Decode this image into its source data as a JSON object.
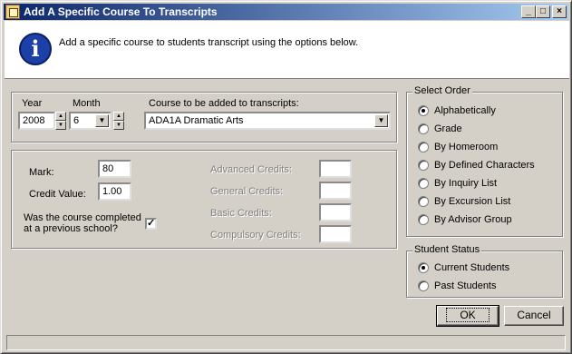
{
  "window": {
    "title": "Add A Specific Course To Transcripts",
    "controls": {
      "minimize": "_",
      "maximize": "□",
      "close": "×"
    }
  },
  "header": {
    "icon": "info-icon",
    "text": "Add a specific course to students transcript using the options below."
  },
  "course_selection": {
    "year_label": "Year",
    "year_value": "2008",
    "month_label": "Month",
    "month_value": "6",
    "course_label": "Course to be added to transcripts:",
    "course_value": "ADA1A  Dramatic Arts"
  },
  "details": {
    "mark_label": "Mark:",
    "mark_value": "80",
    "credit_label": "Credit Value:",
    "credit_value": "1.00",
    "prev_school_label_1": "Was the course completed",
    "prev_school_label_2": "at a previous school?",
    "prev_school_checked": true,
    "advanced_label": "Advanced Credits:",
    "general_label": "General Credits:",
    "basic_label": "Basic Credits:",
    "compulsory_label": "Compulsory Credits:"
  },
  "select_order": {
    "title": "Select Order",
    "options": [
      {
        "label": "Alphabetically",
        "selected": true
      },
      {
        "label": "Grade",
        "selected": false
      },
      {
        "label": "By Homeroom",
        "selected": false
      },
      {
        "label": "By Defined Characters",
        "selected": false
      },
      {
        "label": "By Inquiry List",
        "selected": false
      },
      {
        "label": "By Excursion List",
        "selected": false
      },
      {
        "label": "By Advisor Group",
        "selected": false
      }
    ]
  },
  "student_status": {
    "title": "Student Status",
    "options": [
      {
        "label": "Current Students",
        "selected": true
      },
      {
        "label": "Past Students",
        "selected": false
      }
    ]
  },
  "buttons": {
    "ok": "OK",
    "cancel": "Cancel"
  },
  "colors": {
    "titlebar_start": "#0a246a",
    "titlebar_end": "#a6caf0",
    "face": "#d4d0c8"
  }
}
